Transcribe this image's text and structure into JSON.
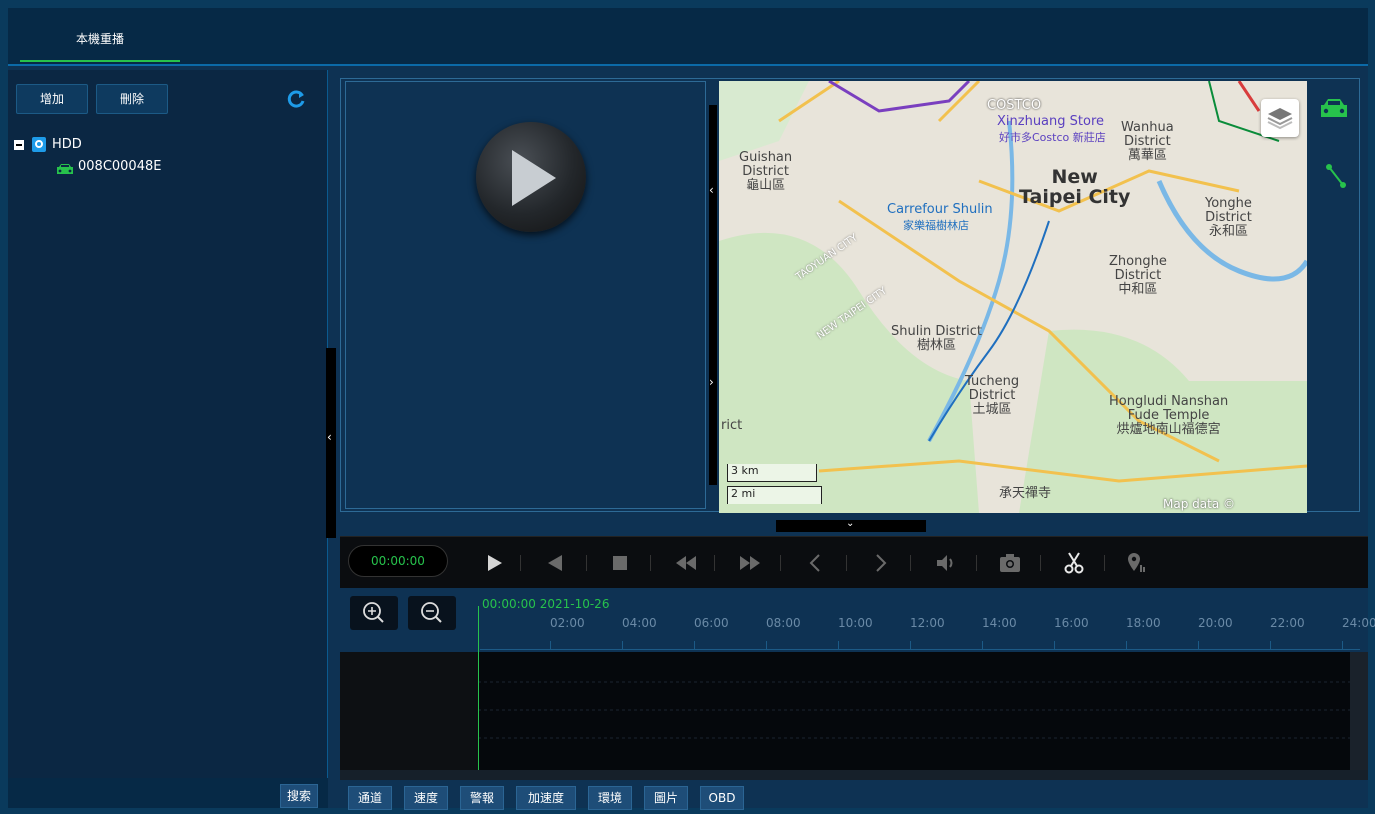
{
  "header": {
    "tab_label": "本機重播"
  },
  "left_panel": {
    "add_button": "增加",
    "delete_button": "刪除",
    "tree": {
      "root_label": "HDD",
      "device_label": "008C00048E"
    },
    "search_button": "搜索"
  },
  "map": {
    "labels": {
      "costco": "COSTCO",
      "xinzhuang_store": "Xinzhuang Store",
      "xinzhuang_store_zh": "好市多Costco 新莊店",
      "guishan": "Guishan\nDistrict\n龜山區",
      "wanhua": "Wanhua\nDistrict\n萬華區",
      "new_taipei": "New\nTaipei City",
      "carrefour": "Carrefour Shulin",
      "carrefour_zh": "家樂福樹林店",
      "yonghe": "Yonghe\nDistrict\n永和區",
      "zhonghe": "Zhonghe\nDistrict\n中和區",
      "shulin": "Shulin District\n樹林區",
      "tucheng": "Tucheng\nDistrict\n土城區",
      "honglu": "Hongludi Nanshan\nFude Temple\n烘爐地南山福德宮",
      "chengtian": "承天禪寺",
      "rict": "rict",
      "taoyuan_city": "TAOYUAN CITY",
      "new_taipei_city": "NEW TAIPEI CITY",
      "scale_km": "3 km",
      "scale_mi": "2 mi",
      "attribution": "Map data ©"
    }
  },
  "controls": {
    "time": "00:00:00"
  },
  "timeline": {
    "date": "00:00:00 2021-10-26",
    "hours": [
      "02:00",
      "04:00",
      "06:00",
      "08:00",
      "10:00",
      "12:00",
      "14:00",
      "16:00",
      "18:00",
      "20:00",
      "22:00",
      "24:00"
    ]
  },
  "bottom_buttons": [
    "通道",
    "速度",
    "警報",
    "加速度",
    "環境",
    "圖片",
    "OBD"
  ],
  "colors": {
    "accent_green": "#27c24c",
    "panel": "#0e3253",
    "border": "#2d6a96"
  }
}
